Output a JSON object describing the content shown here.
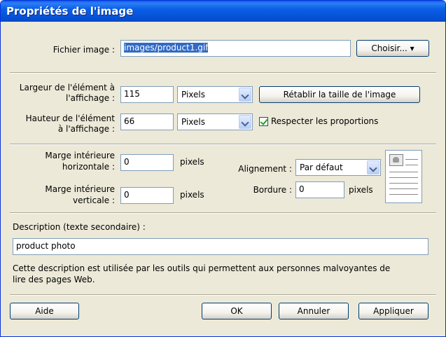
{
  "window": {
    "title": "Propriétés de l'image"
  },
  "file": {
    "label": "Fichier image :",
    "value": "images/product1.gif",
    "choose_button": "Choisir... ▾"
  },
  "size": {
    "width_label_1": "Largeur de l'élément à",
    "width_label_2": "l'affichage :",
    "width_value": "115",
    "width_unit": "Pixels",
    "height_label_1": "Hauteur de l'élément",
    "height_label_2": "à l'affichage :",
    "height_value": "66",
    "height_unit": "Pixels",
    "reset_button": "Rétablir la taille de l'image",
    "keep_ratio_label": "Respecter les proportions",
    "keep_ratio_checked": true
  },
  "spacing": {
    "hmargin_label_1": "Marge intérieure",
    "hmargin_label_2": "horizontale :",
    "hmargin_value": "0",
    "hmargin_unit": "pixels",
    "vmargin_label_1": "Marge intérieure",
    "vmargin_label_2": "verticale :",
    "vmargin_value": "0",
    "vmargin_unit": "pixels",
    "align_label": "Alignement :",
    "align_value": "Par défaut",
    "border_label": "Bordure :",
    "border_value": "0",
    "border_unit": "pixels"
  },
  "description": {
    "label": "Description (texte secondaire) :",
    "value": "product photo",
    "help_line_1": "Cette description est utilisée par les outils qui permettent aux personnes malvoyantes de",
    "help_line_2": "lire des pages Web."
  },
  "buttons": {
    "help": "Aide",
    "ok": "OK",
    "cancel": "Annuler",
    "apply": "Appliquer"
  },
  "colors": {
    "title_bar": "#0a5fe6",
    "dialog_bg": "#ece9d8",
    "selection": "#316ac5",
    "check": "#21a121"
  }
}
